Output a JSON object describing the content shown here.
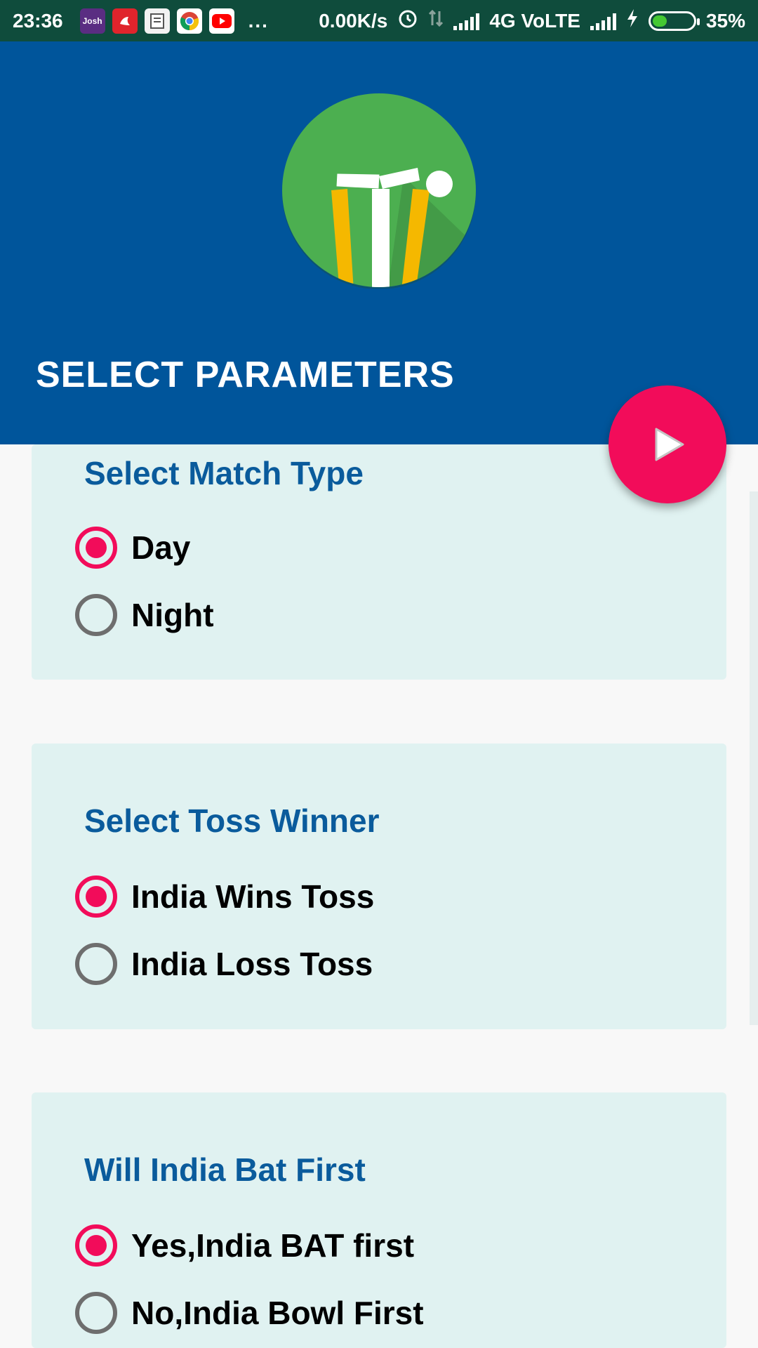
{
  "status_bar": {
    "time": "23:36",
    "network_speed": "0.00K/s",
    "network_type": "4G VoLTE",
    "battery_percent": "35%",
    "battery_level": 0.35,
    "overflow": "...",
    "app_icons": [
      "josh-app-icon",
      "fitness-app-icon",
      "notes-app-icon",
      "chrome-icon",
      "youtube-icon"
    ],
    "josh_label": "Josh"
  },
  "header": {
    "title": "SELECT PARAMETERS",
    "background_color": "#00559b"
  },
  "fab": {
    "icon": "play-icon",
    "color": "#f20c5a"
  },
  "sections": [
    {
      "title": "Select Match Type",
      "options": [
        {
          "label": "Day",
          "checked": true
        },
        {
          "label": "Night",
          "checked": false
        }
      ]
    },
    {
      "title": "Select Toss Winner",
      "options": [
        {
          "label": "India Wins Toss",
          "checked": true
        },
        {
          "label": "India Loss Toss",
          "checked": false
        }
      ]
    },
    {
      "title": "Will India Bat First",
      "options": [
        {
          "label": "Yes,India BAT first",
          "checked": true
        },
        {
          "label": "No,India Bowl First",
          "checked": false
        }
      ]
    }
  ],
  "colors": {
    "accent": "#f20c5a",
    "section_title": "#0a5b9c",
    "card_background": "#e0f2f1",
    "status_bar": "#0f4c3c"
  }
}
